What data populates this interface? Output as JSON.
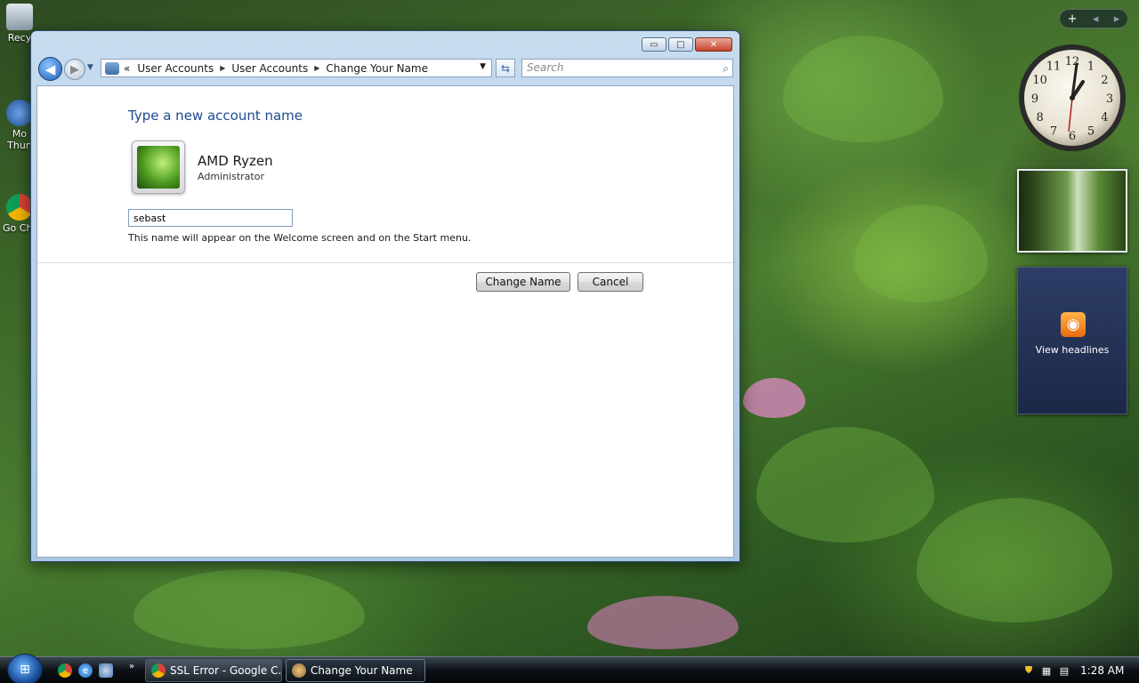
{
  "desktop": {
    "icons": [
      {
        "label": "Recy"
      },
      {
        "label": "Mo Thun"
      },
      {
        "label": "Go Chr"
      }
    ]
  },
  "window": {
    "controls": {
      "minimize": "▭",
      "maximize": "□",
      "close": "✕"
    },
    "nav": {
      "back_glyph": "◀",
      "forward_glyph": "▶",
      "history_glyph": "▼"
    },
    "breadcrumb": {
      "prefix": "«",
      "items": [
        "User Accounts",
        "User Accounts",
        "Change Your Name"
      ],
      "separator": "▶",
      "dropdown": "▼"
    },
    "refresh_glyph": "⇆",
    "search": {
      "placeholder": "Search",
      "icon": "⌕"
    }
  },
  "content": {
    "heading": "Type a new account name",
    "account": {
      "name": "AMD Ryzen",
      "role": "Administrator"
    },
    "name_input_value": "sebast",
    "hint": "This name will appear on the Welcome screen and on the Start menu.",
    "buttons": {
      "change": "Change Name",
      "cancel": "Cancel"
    }
  },
  "sidebar": {
    "controls": {
      "add": "+",
      "prev": "◂",
      "next": "▸"
    },
    "clock": {
      "numbers": [
        "12",
        "1",
        "2",
        "3",
        "4",
        "5",
        "6",
        "7",
        "8",
        "9",
        "10",
        "11"
      ]
    },
    "feed": {
      "label": "View headlines",
      "icon": "rss-icon"
    }
  },
  "taskbar": {
    "start_glyph": "⊞",
    "overflow": "»",
    "tasks": [
      {
        "label": "SSL Error - Google C..."
      },
      {
        "label": "Change Your Name"
      }
    ],
    "clock": "1:28 AM"
  },
  "colors": {
    "heading": "#1e4a8f",
    "window_frame": "#a9c6e2",
    "taskbar": "#0c1116",
    "feed_bg": "#1d2847",
    "rss": "#e96b0c"
  }
}
